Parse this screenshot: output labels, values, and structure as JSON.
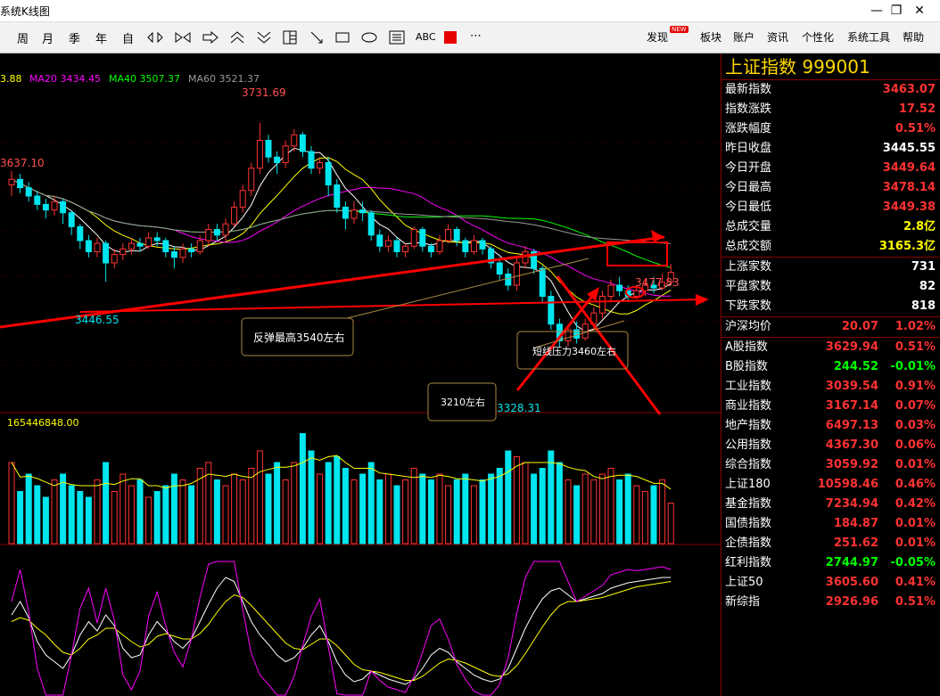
{
  "window": {
    "title": "系统K线图",
    "minimize": "—",
    "maximize": "❐",
    "close": "✕"
  },
  "toolbar": {
    "periods": [
      "周",
      "月",
      "季",
      "年",
      "自"
    ],
    "text_tool": "ABC",
    "more": "⋯",
    "menus": [
      "发现",
      "板块",
      "账户",
      "资讯",
      "个性化",
      "系统工具",
      "帮助"
    ],
    "badge": "NEW"
  },
  "ma_legend": {
    "ma10": "3.88",
    "ma20": "MA20 3434.45",
    "ma40": "MA40 3507.37",
    "ma60": "MA60 3521.37"
  },
  "annotations": {
    "high_left": "3637.10",
    "peak": "3731.69",
    "low_left": "3446.55",
    "low_mid": "3328.31",
    "recent_high": "3477.83",
    "box_rebound": "反弹最高3540左右",
    "box_pressure": "短线压力3460左右",
    "box_support": "3210左右"
  },
  "volume_label": "165446848.00",
  "colors": {
    "up": "#ff3232",
    "down": "#00e5ee",
    "ma5": "#ffffff",
    "ma10": "#ffff00",
    "ma20": "#ff00ff",
    "ma40": "#00ff00",
    "ma60": "#999999",
    "annotation": "#ff0000"
  },
  "panel": {
    "title": "上证指数  999001",
    "quotes": [
      {
        "label": "最新指数",
        "value": "3463.07",
        "color": "#ff3232"
      },
      {
        "label": "指数涨跌",
        "value": "17.52",
        "color": "#ff3232"
      },
      {
        "label": "涨跌幅度",
        "value": "0.51%",
        "color": "#ff3232"
      },
      {
        "label": "昨日收盘",
        "value": "3445.55",
        "color": "#ffffff"
      },
      {
        "label": "今日开盘",
        "value": "3449.64",
        "color": "#ff3232"
      },
      {
        "label": "今日最高",
        "value": "3478.14",
        "color": "#ff3232"
      },
      {
        "label": "今日最低",
        "value": "3449.38",
        "color": "#ff3232"
      },
      {
        "label": "总成交量",
        "value": "2.8亿",
        "color": "#ffff00"
      },
      {
        "label": "总成交额",
        "value": "3165.3亿",
        "color": "#ffff00"
      }
    ],
    "breadth": [
      {
        "label": "上涨家数",
        "value": "731",
        "color": "#ffffff"
      },
      {
        "label": "平盘家数",
        "value": "82",
        "color": "#ffffff"
      },
      {
        "label": "下跌家数",
        "value": "818",
        "color": "#ffffff"
      }
    ],
    "hs_avg": {
      "label": "沪深均价",
      "value": "20.07",
      "pct": "1.02%"
    },
    "indices": [
      {
        "label": "A股指数",
        "value": "3629.94",
        "pct": "0.51%",
        "color": "#ff3232"
      },
      {
        "label": "B股指数",
        "value": "244.52",
        "pct": "-0.01%",
        "color": "#00ff00"
      },
      {
        "label": "工业指数",
        "value": "3039.54",
        "pct": "0.91%",
        "color": "#ff3232"
      },
      {
        "label": "商业指数",
        "value": "3167.14",
        "pct": "0.07%",
        "color": "#ff3232"
      },
      {
        "label": "地产指数",
        "value": "6497.13",
        "pct": "0.03%",
        "color": "#ff3232"
      },
      {
        "label": "公用指数",
        "value": "4367.30",
        "pct": "0.06%",
        "color": "#ff3232"
      },
      {
        "label": "综合指数",
        "value": "3059.92",
        "pct": "0.01%",
        "color": "#ff3232"
      },
      {
        "label": "上证180",
        "value": "10598.46",
        "pct": "0.46%",
        "color": "#ff3232"
      },
      {
        "label": "基金指数",
        "value": "7234.94",
        "pct": "0.42%",
        "color": "#ff3232"
      },
      {
        "label": "国债指数",
        "value": "184.87",
        "pct": "0.01%",
        "color": "#ff3232"
      },
      {
        "label": "企债指数",
        "value": "251.62",
        "pct": "0.01%",
        "color": "#ff3232"
      },
      {
        "label": "红利指数",
        "value": "2744.97",
        "pct": "-0.05%",
        "color": "#00ff00"
      },
      {
        "label": "上证50",
        "value": "3605.60",
        "pct": "0.41%",
        "color": "#ff3232"
      },
      {
        "label": "新综指",
        "value": "2926.96",
        "pct": "0.51%",
        "color": "#ff3232"
      }
    ]
  },
  "chart_data": {
    "type": "candlestick",
    "ylim": [
      3200,
      3760
    ],
    "candles": [
      [
        3620,
        3630,
        3645,
        3600
      ],
      [
        3630,
        3615,
        3640,
        3605
      ],
      [
        3615,
        3600,
        3625,
        3590
      ],
      [
        3600,
        3585,
        3610,
        3575
      ],
      [
        3585,
        3575,
        3595,
        3560
      ],
      [
        3575,
        3590,
        3600,
        3565
      ],
      [
        3590,
        3570,
        3595,
        3550
      ],
      [
        3570,
        3545,
        3575,
        3530
      ],
      [
        3545,
        3520,
        3550,
        3505
      ],
      [
        3520,
        3500,
        3530,
        3490
      ],
      [
        3500,
        3515,
        3525,
        3490
      ],
      [
        3515,
        3480,
        3520,
        3446.55
      ],
      [
        3480,
        3495,
        3505,
        3470
      ],
      [
        3495,
        3505,
        3515,
        3485
      ],
      [
        3505,
        3515,
        3525,
        3495
      ],
      [
        3515,
        3510,
        3525,
        3500
      ],
      [
        3510,
        3525,
        3535,
        3505
      ],
      [
        3525,
        3520,
        3535,
        3510
      ],
      [
        3520,
        3500,
        3525,
        3490
      ],
      [
        3500,
        3490,
        3510,
        3470
      ],
      [
        3490,
        3505,
        3515,
        3480
      ],
      [
        3505,
        3500,
        3515,
        3490
      ],
      [
        3500,
        3520,
        3530,
        3495
      ],
      [
        3520,
        3540,
        3550,
        3510
      ],
      [
        3540,
        3530,
        3550,
        3520
      ],
      [
        3530,
        3550,
        3560,
        3520
      ],
      [
        3550,
        3580,
        3590,
        3545
      ],
      [
        3580,
        3610,
        3620,
        3570
      ],
      [
        3610,
        3650,
        3660,
        3600
      ],
      [
        3650,
        3700,
        3731.69,
        3640
      ],
      [
        3700,
        3670,
        3710,
        3660
      ],
      [
        3670,
        3660,
        3680,
        3640
      ],
      [
        3660,
        3690,
        3700,
        3650
      ],
      [
        3690,
        3710,
        3720,
        3680
      ],
      [
        3710,
        3680,
        3715,
        3670
      ],
      [
        3680,
        3650,
        3690,
        3640
      ],
      [
        3650,
        3660,
        3670,
        3640
      ],
      [
        3660,
        3620,
        3670,
        3600
      ],
      [
        3620,
        3580,
        3630,
        3570
      ],
      [
        3580,
        3560,
        3590,
        3540
      ],
      [
        3560,
        3575,
        3590,
        3550
      ],
      [
        3575,
        3570,
        3590,
        3555
      ],
      [
        3570,
        3530,
        3575,
        3520
      ],
      [
        3530,
        3510,
        3540,
        3500
      ],
      [
        3510,
        3520,
        3530,
        3500
      ],
      [
        3520,
        3500,
        3525,
        3490
      ],
      [
        3500,
        3510,
        3515,
        3490
      ],
      [
        3510,
        3540,
        3545,
        3505
      ],
      [
        3540,
        3510,
        3545,
        3500
      ],
      [
        3510,
        3500,
        3515,
        3490
      ],
      [
        3500,
        3520,
        3530,
        3495
      ],
      [
        3520,
        3540,
        3550,
        3515
      ],
      [
        3540,
        3520,
        3545,
        3510
      ],
      [
        3520,
        3500,
        3525,
        3490
      ],
      [
        3500,
        3520,
        3530,
        3495
      ],
      [
        3520,
        3505,
        3525,
        3495
      ],
      [
        3505,
        3480,
        3510,
        3470
      ],
      [
        3480,
        3460,
        3490,
        3450
      ],
      [
        3460,
        3440,
        3470,
        3430
      ],
      [
        3440,
        3480,
        3490,
        3430
      ],
      [
        3480,
        3500,
        3510,
        3470
      ],
      [
        3500,
        3470,
        3505,
        3460
      ],
      [
        3470,
        3420,
        3475,
        3410
      ],
      [
        3420,
        3370,
        3430,
        3360
      ],
      [
        3370,
        3340,
        3380,
        3328.31
      ],
      [
        3340,
        3360,
        3370,
        3330
      ],
      [
        3360,
        3345,
        3375,
        3335
      ],
      [
        3345,
        3370,
        3380,
        3340
      ],
      [
        3370,
        3390,
        3400,
        3360
      ],
      [
        3390,
        3420,
        3430,
        3380
      ],
      [
        3420,
        3440,
        3450,
        3410
      ],
      [
        3440,
        3430,
        3455,
        3420
      ],
      [
        3430,
        3420,
        3440,
        3410
      ],
      [
        3420,
        3430,
        3440,
        3415
      ],
      [
        3430,
        3440,
        3450,
        3420
      ],
      [
        3440,
        3435,
        3455,
        3425
      ],
      [
        3435,
        3445,
        3460,
        3430
      ],
      [
        3445.55,
        3463.07,
        3478.14,
        3449.38
      ]
    ],
    "volumes": [
      0.7,
      0.45,
      0.6,
      0.5,
      0.4,
      0.55,
      0.6,
      0.5,
      0.45,
      0.4,
      0.55,
      0.7,
      0.45,
      0.6,
      0.5,
      0.55,
      0.4,
      0.45,
      0.5,
      0.6,
      0.55,
      0.5,
      0.65,
      0.7,
      0.55,
      0.5,
      0.6,
      0.55,
      0.65,
      0.8,
      0.6,
      0.7,
      0.55,
      0.7,
      0.95,
      0.8,
      0.6,
      0.7,
      0.75,
      0.65,
      0.55,
      0.6,
      0.7,
      0.55,
      0.6,
      0.5,
      0.55,
      0.65,
      0.6,
      0.55,
      0.6,
      0.5,
      0.55,
      0.6,
      0.5,
      0.55,
      0.6,
      0.65,
      0.8,
      0.75,
      0.7,
      0.6,
      0.65,
      0.8,
      0.7,
      0.55,
      0.5,
      0.6,
      0.55,
      0.6,
      0.65,
      0.55,
      0.6,
      0.5,
      0.45,
      0.5,
      0.55,
      0.35
    ],
    "kdj_k": [
      60,
      70,
      58,
      40,
      30,
      25,
      20,
      30,
      45,
      55,
      48,
      60,
      52,
      35,
      28,
      30,
      45,
      55,
      48,
      40,
      35,
      42,
      55,
      68,
      80,
      88,
      85,
      70,
      55,
      45,
      38,
      30,
      25,
      28,
      35,
      45,
      52,
      40,
      25,
      15,
      10,
      12,
      18,
      15,
      12,
      10,
      8,
      12,
      20,
      30,
      35,
      32,
      25,
      20,
      15,
      12,
      10,
      12,
      20,
      35,
      50,
      62,
      72,
      78,
      80,
      75,
      70,
      72,
      74,
      76,
      80,
      82,
      84,
      85,
      86,
      87,
      88,
      88
    ],
    "kdj_d": [
      55,
      58,
      56,
      50,
      45,
      38,
      32,
      30,
      35,
      42,
      45,
      50,
      50,
      45,
      40,
      36,
      38,
      44,
      46,
      44,
      42,
      42,
      46,
      53,
      62,
      70,
      75,
      73,
      67,
      60,
      53,
      46,
      39,
      35,
      34,
      38,
      42,
      42,
      37,
      30,
      23,
      19,
      18,
      17,
      15,
      13,
      11,
      11,
      14,
      19,
      24,
      27,
      26,
      24,
      21,
      18,
      15,
      14,
      16,
      22,
      31,
      41,
      51,
      60,
      67,
      70,
      70,
      71,
      72,
      73,
      75,
      77,
      79,
      81,
      82,
      83,
      84,
      85
    ],
    "kdj_j": [
      70,
      94,
      62,
      20,
      0,
      0,
      0,
      30,
      65,
      80,
      54,
      80,
      56,
      15,
      4,
      18,
      59,
      77,
      52,
      32,
      21,
      42,
      73,
      98,
      100,
      100,
      100,
      64,
      31,
      15,
      8,
      0,
      0,
      14,
      37,
      59,
      72,
      36,
      1,
      0,
      0,
      0,
      18,
      11,
      6,
      4,
      2,
      14,
      32,
      52,
      57,
      42,
      23,
      12,
      3,
      0,
      0,
      8,
      28,
      61,
      88,
      100,
      100,
      100,
      100,
      85,
      70,
      74,
      78,
      82,
      90,
      92,
      94,
      93,
      94,
      95,
      96,
      94
    ]
  }
}
